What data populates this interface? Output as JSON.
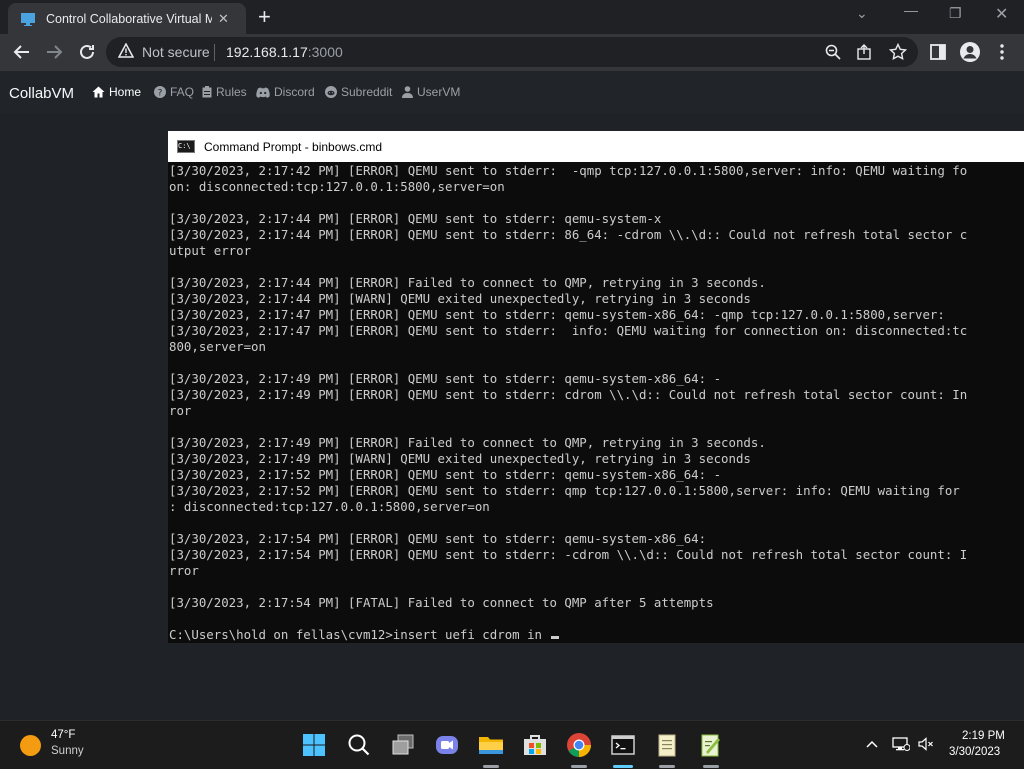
{
  "browser": {
    "tab": {
      "title": "Control Collaborative Virtual Mac",
      "close": "✕"
    },
    "new_tab": "+",
    "address": {
      "security_label": "Not secure",
      "host": "192.168.1.17",
      "port": ":3000"
    }
  },
  "site": {
    "brand": "CollabVM",
    "nav": [
      {
        "label": "Home",
        "icon": "home-icon"
      },
      {
        "label": "FAQ",
        "icon": "question-circle-icon"
      },
      {
        "label": "Rules",
        "icon": "clipboard-icon"
      },
      {
        "label": "Discord",
        "icon": "discord-icon"
      },
      {
        "label": "Subreddit",
        "icon": "reddit-icon"
      },
      {
        "label": "UserVM",
        "icon": "user-icon"
      }
    ]
  },
  "console": {
    "title": "Command Prompt - binbows.cmd",
    "icon_text": "C:\\",
    "lines": [
      "[3/30/2023, 2:17:42 PM] [ERROR] QEMU sent to stderr:  -qmp tcp:127.0.0.1:5800,server: info: QEMU waiting fo",
      "on: disconnected:tcp:127.0.0.1:5800,server=on",
      "",
      "[3/30/2023, 2:17:44 PM] [ERROR] QEMU sent to stderr: qemu-system-x",
      "[3/30/2023, 2:17:44 PM] [ERROR] QEMU sent to stderr: 86_64: -cdrom \\\\.\\d:: Could not refresh total sector c",
      "utput error",
      "",
      "[3/30/2023, 2:17:44 PM] [ERROR] Failed to connect to QMP, retrying in 3 seconds.",
      "[3/30/2023, 2:17:44 PM] [WARN] QEMU exited unexpectedly, retrying in 3 seconds",
      "[3/30/2023, 2:17:47 PM] [ERROR] QEMU sent to stderr: qemu-system-x86_64: -qmp tcp:127.0.0.1:5800,server:",
      "[3/30/2023, 2:17:47 PM] [ERROR] QEMU sent to stderr:  info: QEMU waiting for connection on: disconnected:tc",
      "800,server=on",
      "",
      "[3/30/2023, 2:17:49 PM] [ERROR] QEMU sent to stderr: qemu-system-x86_64: -",
      "[3/30/2023, 2:17:49 PM] [ERROR] QEMU sent to stderr: cdrom \\\\.\\d:: Could not refresh total sector count: In",
      "ror",
      "",
      "[3/30/2023, 2:17:49 PM] [ERROR] Failed to connect to QMP, retrying in 3 seconds.",
      "[3/30/2023, 2:17:49 PM] [WARN] QEMU exited unexpectedly, retrying in 3 seconds",
      "[3/30/2023, 2:17:52 PM] [ERROR] QEMU sent to stderr: qemu-system-x86_64: -",
      "[3/30/2023, 2:17:52 PM] [ERROR] QEMU sent to stderr: qmp tcp:127.0.0.1:5800,server: info: QEMU waiting for",
      ": disconnected:tcp:127.0.0.1:5800,server=on",
      "",
      "[3/30/2023, 2:17:54 PM] [ERROR] QEMU sent to stderr: qemu-system-x86_64:",
      "[3/30/2023, 2:17:54 PM] [ERROR] QEMU sent to stderr: -cdrom \\\\.\\d:: Could not refresh total sector count: I",
      "rror",
      "",
      "[3/30/2023, 2:17:54 PM] [FATAL] Failed to connect to QMP after 5 attempts",
      ""
    ],
    "prompt": "C:\\Users\\hold on fellas\\cvm12>insert uefi cdrom in "
  },
  "taskbar": {
    "weather": {
      "temp": "47°F",
      "condition": "Sunny"
    },
    "apps": [
      {
        "name": "windows-start-icon"
      },
      {
        "name": "search-icon"
      },
      {
        "name": "task-view-icon"
      },
      {
        "name": "teams-chat-icon"
      },
      {
        "name": "file-explorer-icon"
      },
      {
        "name": "microsoft-store-icon"
      },
      {
        "name": "chrome-icon"
      },
      {
        "name": "command-prompt-icon"
      },
      {
        "name": "notepad-icon"
      },
      {
        "name": "notepad-plus-icon"
      }
    ],
    "clock": {
      "time": "2:19 PM",
      "date": "3/30/2023"
    }
  },
  "colors": {
    "console_bg": "#0c0c0c",
    "console_text": "#cccccc",
    "page_bg": "#1f2328",
    "taskbar_bg": "#1c1c1c"
  }
}
